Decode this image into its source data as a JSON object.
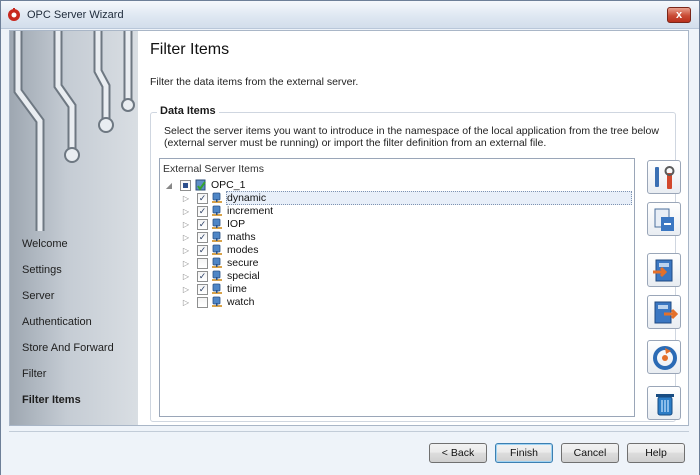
{
  "window": {
    "title": "OPC Server Wizard",
    "close_glyph": "x"
  },
  "nav": {
    "items": [
      {
        "label": "Welcome",
        "active": false
      },
      {
        "label": "Settings",
        "active": false
      },
      {
        "label": "Server",
        "active": false
      },
      {
        "label": "Authentication",
        "active": false
      },
      {
        "label": "Store And Forward",
        "active": false
      },
      {
        "label": "Filter",
        "active": false
      },
      {
        "label": "Filter Items",
        "active": true
      }
    ]
  },
  "page": {
    "title": "Filter Items",
    "description": "Filter the data items from the external server."
  },
  "data_items": {
    "group_title": "Data Items",
    "description": "Select the server items you want to introduce in the namespace of the local application from the tree below (external server must be running) or import the filter definition from an external file.",
    "tree_header": "External Server Items",
    "root": {
      "label": "OPC_1",
      "state": "partial",
      "expanded": true
    },
    "items": [
      {
        "label": "dynamic",
        "checked": true,
        "selected": true
      },
      {
        "label": "increment",
        "checked": true,
        "selected": false
      },
      {
        "label": "IOP",
        "checked": true,
        "selected": false
      },
      {
        "label": "maths",
        "checked": true,
        "selected": false
      },
      {
        "label": "modes",
        "checked": true,
        "selected": false
      },
      {
        "label": "secure",
        "checked": false,
        "selected": false
      },
      {
        "label": "special",
        "checked": true,
        "selected": false
      },
      {
        "label": "time",
        "checked": true,
        "selected": false
      },
      {
        "label": "watch",
        "checked": false,
        "selected": false
      }
    ]
  },
  "tools": [
    {
      "icon": "settings-tools-icon"
    },
    {
      "icon": "import-filter-icon"
    },
    {
      "icon": "import-icon"
    },
    {
      "icon": "export-icon"
    },
    {
      "icon": "refresh-icon"
    },
    {
      "icon": "delete-icon"
    }
  ],
  "buttons": {
    "back": "< Back",
    "finish": "Finish",
    "cancel": "Cancel",
    "help": "Help"
  },
  "colors": {
    "accent": "#2b4e8c",
    "window_bg": "#eef3f9"
  }
}
